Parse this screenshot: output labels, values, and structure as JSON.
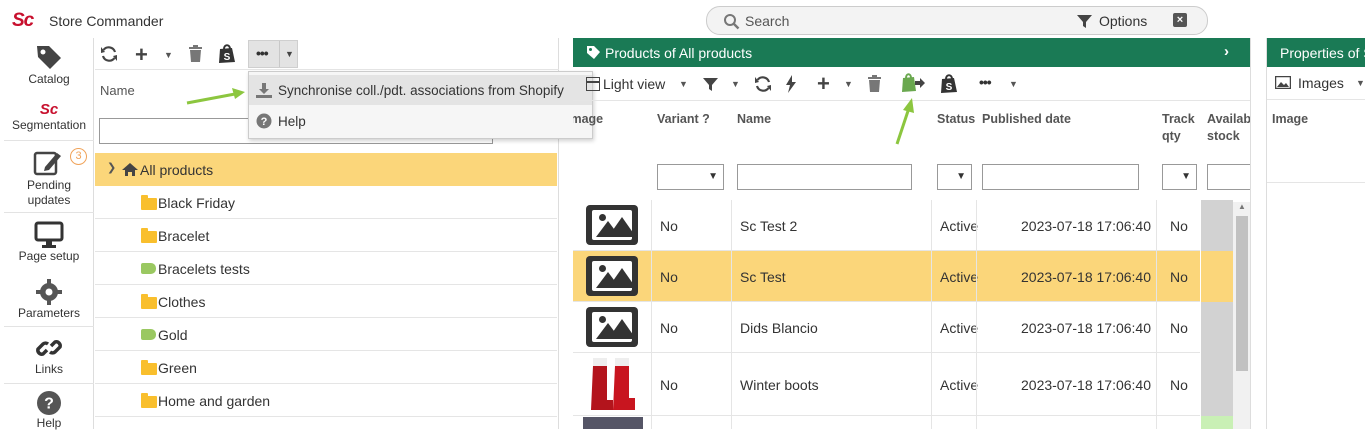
{
  "app": {
    "title": "Store Commander",
    "logo": "Sc"
  },
  "search": {
    "placeholder": "Search",
    "options_label": "Options",
    "close_glyph": "×"
  },
  "left_nav": {
    "items": [
      {
        "label": "Catalog",
        "icon": "tag-icon"
      },
      {
        "label": "Segmentation",
        "icon": "segmentation-logo-icon",
        "logo": "Sc"
      },
      {
        "label": "Pending updates",
        "icon": "pending-edit-icon",
        "badge": "3"
      },
      {
        "label": "Page setup",
        "icon": "monitor-icon"
      },
      {
        "label": "Parameters",
        "icon": "gear-icon"
      },
      {
        "label": "Links",
        "icon": "link-icon"
      },
      {
        "label": "Help",
        "icon": "help-icon"
      }
    ]
  },
  "categories": {
    "column_header": "Name",
    "toolbar_more": "•••",
    "tree": [
      {
        "label": "All products",
        "type": "root",
        "selected": true
      },
      {
        "label": "Black Friday",
        "type": "folder"
      },
      {
        "label": "Bracelet",
        "type": "folder"
      },
      {
        "label": "Bracelets tests",
        "type": "tag"
      },
      {
        "label": "Clothes",
        "type": "folder"
      },
      {
        "label": "Gold",
        "type": "tag"
      },
      {
        "label": "Green",
        "type": "folder"
      },
      {
        "label": "Home and garden",
        "type": "folder"
      }
    ]
  },
  "dropdown_menu": {
    "items": [
      {
        "label": "Synchronise coll./pdt. associations from Shopify",
        "icon": "download-icon"
      },
      {
        "label": "Help",
        "icon": "help-icon"
      }
    ]
  },
  "products": {
    "header": "Products of All products",
    "view_label": "Light view",
    "more": "•••",
    "columns": {
      "image": "Image",
      "variant": "Variant ?",
      "name": "Name",
      "status": "Status",
      "published": "Published date",
      "track_qty_1": "Track",
      "track_qty_2": "qty",
      "stock_1": "Available",
      "stock_2": "stock"
    },
    "rows": [
      {
        "variant": "No",
        "name": "Sc Test 2",
        "status": "Active",
        "published": "2023-07-18 17:06:40",
        "track": "No",
        "selected": false
      },
      {
        "variant": "No",
        "name": "Sc Test",
        "status": "Active",
        "published": "2023-07-18 17:06:40",
        "track": "No",
        "selected": true
      },
      {
        "variant": "No",
        "name": "Dids Blancio",
        "status": "Active",
        "published": "2023-07-18 17:06:40",
        "track": "No",
        "selected": false
      },
      {
        "variant": "No",
        "name": "Winter boots",
        "status": "Active",
        "published": "2023-07-18 17:06:40",
        "track": "No",
        "selected": false
      }
    ]
  },
  "properties": {
    "header": "Properties of S",
    "view_label": "Images",
    "column": "Image"
  },
  "colors": {
    "accent_green": "#1a7a55",
    "selection": "#fbd67a",
    "folder": "#f9bf2d",
    "tag": "#9ac861",
    "arrow": "#8cc63f",
    "logo_red": "#c8102e"
  }
}
